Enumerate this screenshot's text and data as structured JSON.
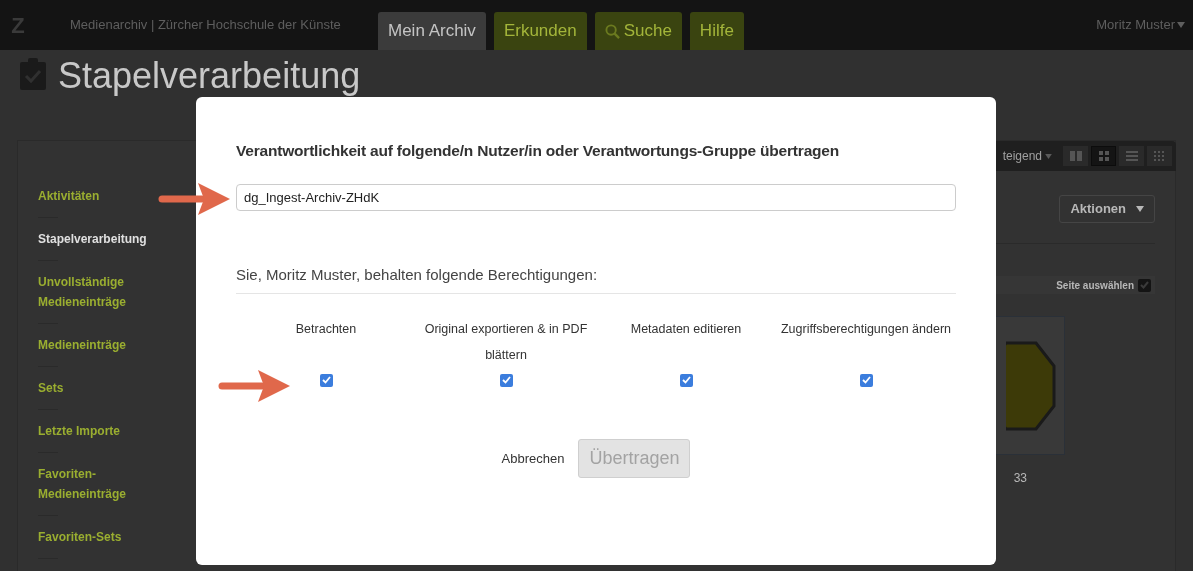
{
  "header": {
    "logo": "Z",
    "site_title": "Medienarchiv | Zürcher Hochschule der Künste",
    "tabs": [
      {
        "label": "Mein Archiv",
        "kind": "plain",
        "selected": true
      },
      {
        "label": "Erkunden",
        "kind": "plain",
        "selected": false
      },
      {
        "label": "Suche",
        "kind": "search",
        "selected": false
      },
      {
        "label": "Hilfe",
        "kind": "plain",
        "selected": false
      }
    ],
    "user_menu": "Moritz Muster"
  },
  "page_title": "Stapelverarbeitung",
  "sidebar": {
    "items": [
      {
        "label": "Aktivitäten",
        "selected": false
      },
      {
        "label": "Stapelverarbeitung",
        "selected": true
      },
      {
        "label": "Unvollständige Medieneinträge",
        "selected": false
      },
      {
        "label": "Medieneinträge",
        "selected": false
      },
      {
        "label": "Sets",
        "selected": false
      },
      {
        "label": "Letzte Importe",
        "selected": false
      },
      {
        "label": "Favoriten-Medieneinträge",
        "selected": false
      },
      {
        "label": "Favoriten-Sets",
        "selected": false
      }
    ]
  },
  "toolbar": {
    "sort": "teigend",
    "layouts": [
      {
        "kind": "columns",
        "selected": false
      },
      {
        "kind": "grid",
        "selected": true
      },
      {
        "kind": "list",
        "selected": false
      },
      {
        "kind": "dots",
        "selected": false
      }
    ],
    "actions_button": "Aktionen",
    "select_page": {
      "label": "Seite auswählen",
      "checked": true
    }
  },
  "card": {
    "caption": "33"
  },
  "dialog": {
    "heading": "Verantwortlichkeit auf folgende/n Nutzer/in oder Verantwortungs-Gruppe übertragen",
    "user_field": {
      "value": "dg_Ingest-Archiv-ZHdK"
    },
    "permissions_label": "Sie, Moritz Muster, behalten folgende Berechtigungen:",
    "permissions": [
      {
        "label": "Betrachten",
        "checked": true
      },
      {
        "label": "Original exportieren & in PDF blättern",
        "checked": true
      },
      {
        "label": "Metadaten editieren",
        "checked": true
      },
      {
        "label": "Zugriffsberechtigungen ändern",
        "checked": true
      }
    ],
    "cancel": "Abbrechen",
    "submit": {
      "label": "Übertragen",
      "disabled": true
    }
  }
}
